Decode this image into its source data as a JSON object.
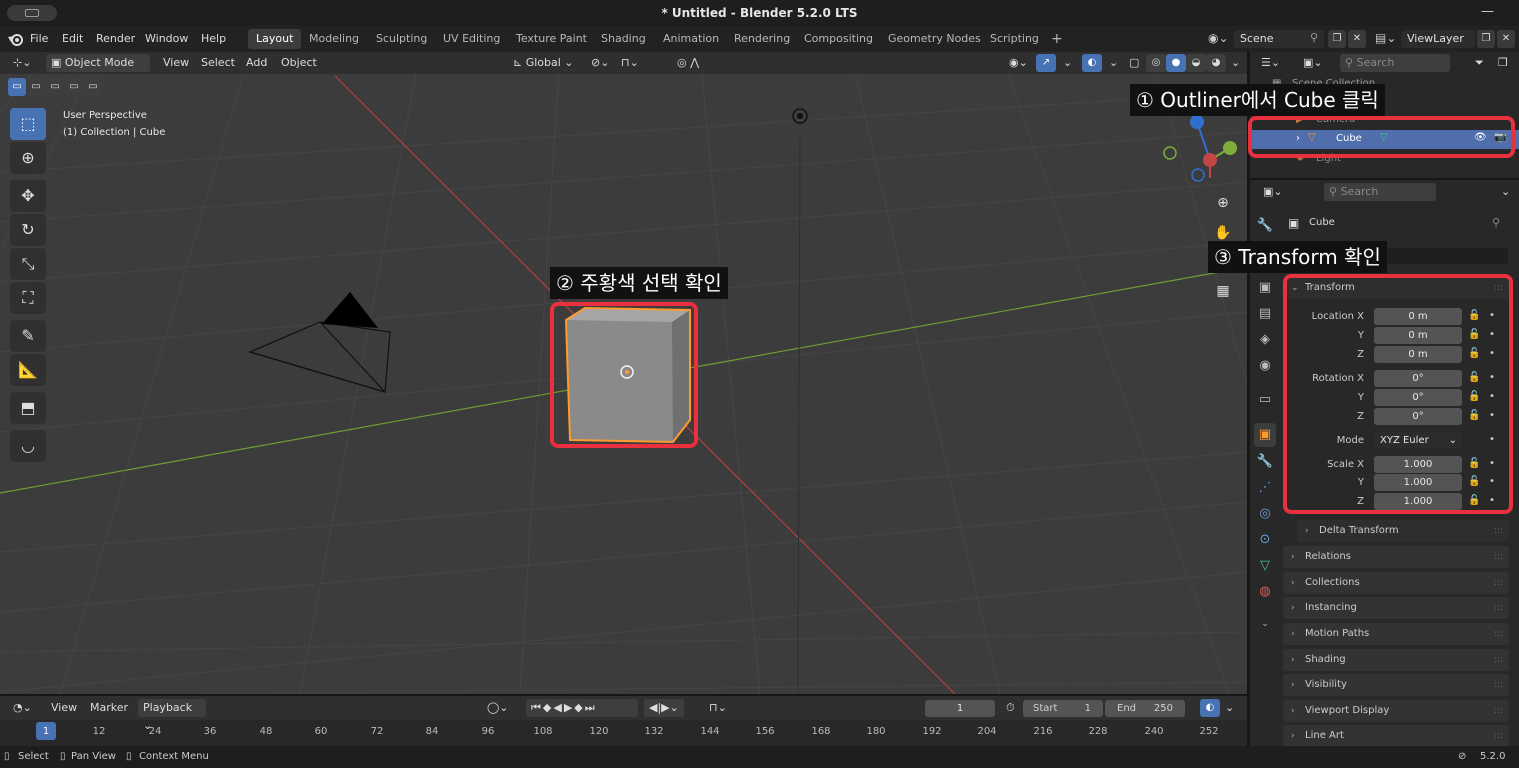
{
  "window": {
    "title": "* Untitled - Blender 5.2.0 LTS",
    "minimize": "—"
  },
  "menu": [
    "File",
    "Edit",
    "Render",
    "Window",
    "Help"
  ],
  "workspaces": [
    "Layout",
    "Modeling",
    "Sculpting",
    "UV Editing",
    "Texture Paint",
    "Shading",
    "Animation",
    "Rendering",
    "Compositing",
    "Geometry Nodes",
    "Scripting"
  ],
  "add_workspace": "+",
  "scene": {
    "name": "Scene",
    "view_layer": "ViewLayer"
  },
  "viewport": {
    "mode": "Object Mode",
    "menus": [
      "View",
      "Select",
      "Add",
      "Object"
    ],
    "transform_orientation": "Global",
    "overlay_text": {
      "perspective": "User Perspective",
      "collection": "(1) Collection | Cube"
    }
  },
  "outliner": {
    "search_placeholder": "Search",
    "items": [
      "Scene Collection",
      "Camera",
      "Cube",
      "Light"
    ]
  },
  "properties": {
    "search_placeholder": "Search",
    "object_name": "Cube",
    "transform_panel": "Transform",
    "labels": {
      "location_x": "Location X",
      "y": "Y",
      "z": "Z",
      "rotation_x": "Rotation X",
      "mode": "Mode",
      "scale_x": "Scale X"
    },
    "location": [
      "0 m",
      "0 m",
      "0 m"
    ],
    "rotation": [
      "0°",
      "0°",
      "0°"
    ],
    "rotation_mode": "XYZ Euler",
    "scale": [
      "1.000",
      "1.000",
      "1.000"
    ],
    "panels": [
      "Delta Transform",
      "Relations",
      "Collections",
      "Instancing",
      "Motion Paths",
      "Shading",
      "Visibility",
      "Viewport Display",
      "Line Art"
    ]
  },
  "timeline": {
    "menus": [
      "View",
      "Marker",
      "Playback"
    ],
    "current_frame": "1",
    "start_label": "Start",
    "start": "1",
    "end_label": "End",
    "end": "250",
    "frames": [
      "1",
      "12",
      "24",
      "36",
      "48",
      "60",
      "72",
      "84",
      "96",
      "108",
      "120",
      "132",
      "144",
      "156",
      "168",
      "180",
      "192",
      "204",
      "216",
      "228",
      "240",
      "252"
    ]
  },
  "status": {
    "select": "Select",
    "pan": "Pan View",
    "context": "Context Menu",
    "version": "5.2.0"
  },
  "annotations": {
    "outliner_step": "① Outliner에서 Cube 클릭",
    "viewport_step": "② 주황색 선택 확인",
    "transform_step": "③ Transform 확인"
  },
  "colors": {
    "accent_blue": "#4772b3",
    "selection_orange": "#ff9a2e",
    "annotation_red": "#e8303f",
    "x_axis": "#c24646",
    "y_axis": "#7fae3a"
  }
}
